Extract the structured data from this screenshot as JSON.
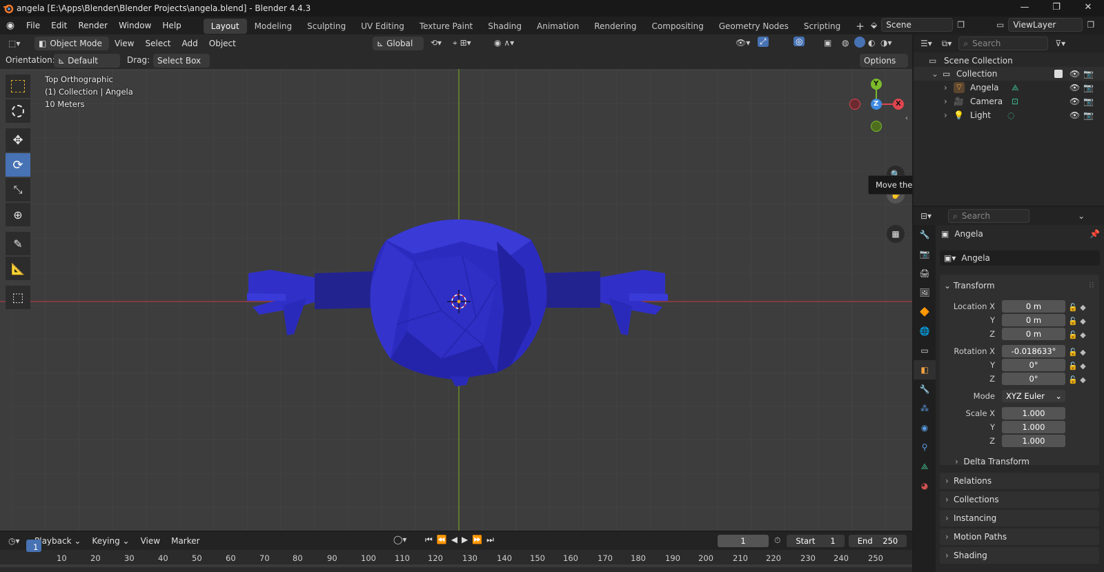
{
  "window": {
    "title": "angela [E:\\Apps\\Blender\\Blender Projects\\angela.blend] - Blender 4.4.3",
    "minimize": "—",
    "maximize": "❐",
    "close": "✕"
  },
  "menu": [
    "File",
    "Edit",
    "Render",
    "Window",
    "Help"
  ],
  "workspaces": [
    "Layout",
    "Modeling",
    "Sculpting",
    "UV Editing",
    "Texture Paint",
    "Shading",
    "Animation",
    "Rendering",
    "Compositing",
    "Geometry Nodes",
    "Scripting"
  ],
  "active_workspace": "Layout",
  "scene": {
    "name": "Scene",
    "viewlayer": "ViewLayer"
  },
  "viewport": {
    "mode": "Object Mode",
    "menus": [
      "View",
      "Select",
      "Add",
      "Object"
    ],
    "transform_space": "Global",
    "orientation_label": "Orientation:",
    "orientation_value": "Default",
    "drag_label": "Drag:",
    "drag_value": "Select Box",
    "options": "Options",
    "overlay_lines": [
      "Top Orthographic",
      "(1) Collection | Angela",
      "10 Meters"
    ],
    "tooltip": "Move the view",
    "gizmo": {
      "x": "X",
      "y": "Y",
      "z": "Z"
    },
    "mesh_color": "#2a2ab8"
  },
  "outliner": {
    "search_placeholder": "Search",
    "root": "Scene Collection",
    "collection": "Collection",
    "items": [
      "Angela",
      "Camera",
      "Light"
    ]
  },
  "properties": {
    "search_placeholder": "Search",
    "object_name": "Angela",
    "data_name": "Angela",
    "transform": "Transform",
    "location": {
      "label": "Location X",
      "x": "0 m",
      "y": "0 m",
      "z": "0 m"
    },
    "rotation": {
      "label": "Rotation X",
      "x": "-0.018633°",
      "y": "0°",
      "z": "0°"
    },
    "mode_label": "Mode",
    "mode_value": "XYZ Euler",
    "scale": {
      "label": "Scale X",
      "x": "1.000",
      "y": "1.000",
      "z": "1.000"
    },
    "axis_y": "Y",
    "axis_z": "Z",
    "sections": [
      "Delta Transform",
      "Relations",
      "Collections",
      "Instancing",
      "Motion Paths",
      "Shading"
    ]
  },
  "timeline": {
    "menus": [
      "Playback",
      "Keying",
      "View",
      "Marker"
    ],
    "current_frame": "1",
    "start_label": "Start",
    "start": "1",
    "end_label": "End",
    "end": "250",
    "ticks": [
      "1",
      "10",
      "20",
      "30",
      "40",
      "50",
      "60",
      "70",
      "80",
      "90",
      "100",
      "110",
      "120",
      "130",
      "140",
      "150",
      "160",
      "170",
      "180",
      "190",
      "200",
      "210",
      "220",
      "230",
      "240",
      "250"
    ]
  }
}
